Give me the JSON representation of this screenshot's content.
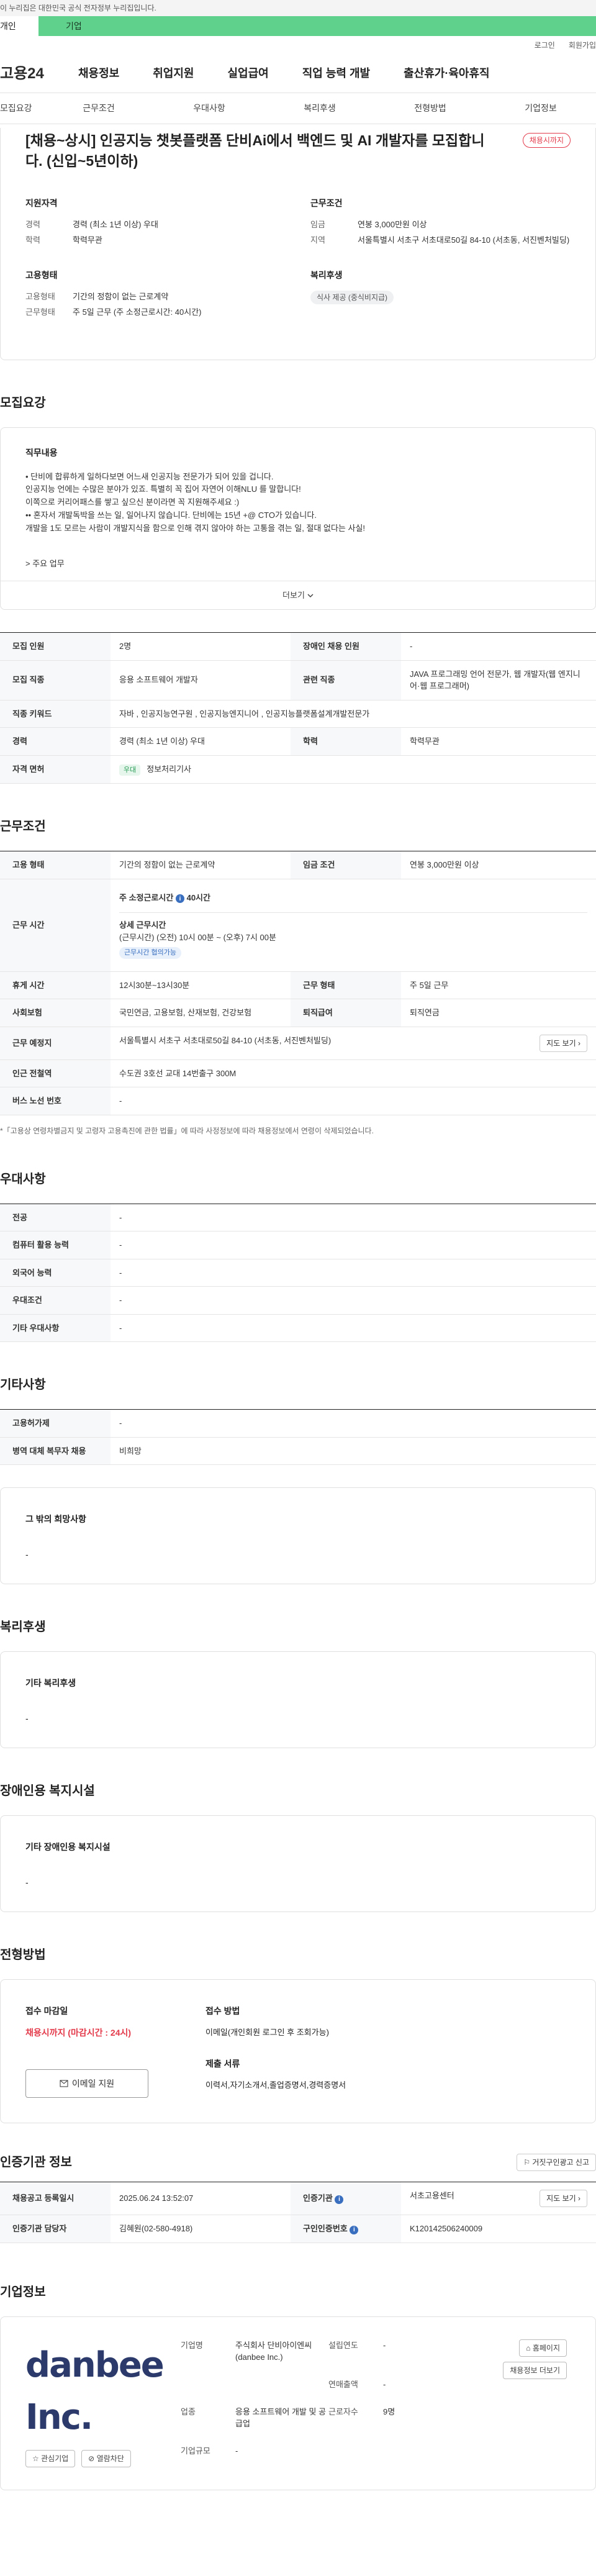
{
  "gov_banner": "이 누리집은 대한민국 공식 전자정부 누리집입니다.",
  "top_tabs": [
    "개인",
    "기업"
  ],
  "util_links": [
    "로그인",
    "회원가입"
  ],
  "logo": "고용24",
  "gnb": [
    "채용정보",
    "취업지원",
    "실업급여",
    "직업 능력 개발",
    "출산휴가·육아휴직"
  ],
  "subnav": [
    "모집요강",
    "근무조건",
    "우대사항",
    "복리후생",
    "전형방법",
    "기업정보"
  ],
  "summary": {
    "title": "[채용~상시] 인공지능 챗봇플랫폼 단비Ai에서 백엔드 및 AI 개발자를 모집합니다. (신입~5년이하)",
    "status_badge": "채용시까지",
    "qualification": {
      "heading": "지원자격",
      "rows": [
        {
          "k": "경력",
          "v": "경력 (최소 1년 이상) 우대"
        },
        {
          "k": "학력",
          "v": "학력무관"
        }
      ]
    },
    "work_conditions": {
      "heading": "근무조건",
      "rows": [
        {
          "k": "임금",
          "v": "연봉 3,000만원 이상"
        },
        {
          "k": "지역",
          "v": "서울특별시 서초구 서초대로50길 84-10 (서초동, 서진벤처빌딩)"
        }
      ]
    },
    "employment_type": {
      "heading": "고용형태",
      "rows": [
        {
          "k": "고용형태",
          "v": "기간의 정함이 없는 근로계약"
        },
        {
          "k": "근무형태",
          "v": "주 5일 근무 (주 소정근로시간: 40시간)"
        }
      ]
    },
    "welfare": {
      "heading": "복리후생",
      "pill": "식사 제공 (중식비지급)"
    }
  },
  "recruit": {
    "heading": "모집요강",
    "duty_heading": "직무내용",
    "duty_text": "• 단비에 합류하게 일하다보면 어느새 인공지능 전문가가 되어 있을 겁니다.\n 인공지능 언에는 수많은 분야가 있죠. 특별히 꼭 집어 자연어 이해NLU 를 말합니다!\n 이쪽으로 커리어패스를 쌓고 싶으신 분이라면 꼭 지원해주세요 :)\n•• 혼자서 개발독박을 쓰는 일, 일어나지 않습니다. 단비에는 15년 +@ CTO가 있습니다.\n 개발을 1도 모르는 사람이 개발지식을 함으로 인해 겪지 않아야 하는 고통을 겪는 일, 절대 없다는 사실!",
    "duty_more": "> 주요 업무",
    "more_button": "더보기",
    "table": [
      {
        "k1": "모집 인원",
        "v1": "2명",
        "k2": "장애인 채용 인원",
        "v2": "-"
      },
      {
        "k1": "모집 직종",
        "v1": "응용 소프트웨어 개발자",
        "k2": "관련 직종",
        "v2": "JAVA 프로그래밍 언어 전문가, 웹 개발자(웹 엔지니어·웹 프로그래머)"
      },
      {
        "k1": "직종 키워드",
        "v1": "자바 , 인공지능연구원 , 인공지능엔지니어 , 인공지능플랫폼설계개발전문가"
      },
      {
        "k1": "경력",
        "v1": "경력 (최소 1년 이상) 우대",
        "k2": "학력",
        "v2": "학력무관"
      },
      {
        "k1": "자격 면허",
        "tag": "우대",
        "v1": "정보처리기사"
      }
    ]
  },
  "conditions": {
    "heading": "근무조건",
    "employment_form_k": "고용 형태",
    "employment_form_v": "기간의 정함이 없는 근로계약",
    "wage_k": "임금 조건",
    "wage_v": "연봉 3,000만원 이상",
    "hours_k": "근무 시간",
    "hours_total": "주 소정근로시간",
    "hours_total_val": "40시간",
    "hours_detail_h": "상세 근무시간",
    "hours_detail": "(근무시간) (오전) 10시 00분 ~ (오후) 7시 00분",
    "hours_pill": "근무시간 협의가능",
    "break_k": "휴게 시간",
    "break_v": "12시30분~13시30분",
    "form_k": "근무 형태",
    "form_v": "주 5일 근무",
    "insurance_k": "사회보험",
    "insurance_v": "국민연금, 고용보험, 산재보험, 건강보험",
    "retire_k": "퇴직급여",
    "retire_v": "퇴직연금",
    "location_k": "근무 예정지",
    "location_v": "서울특별시 서초구 서초대로50길 84-10 (서초동, 서진벤처빌딩)",
    "map_button": "지도 보기",
    "station_k": "인근 전철역",
    "station_v": "수도권 3호선 교대 14번출구 300M",
    "bus_k": "버스 노선 번호",
    "bus_v": "-",
    "note": "*「고용상 연령차별금지 및 고령자 고용촉진에 관한 법률」에 따라 사정정보에 따라 채용정보에서 연령이 삭제되었습니다."
  },
  "preference": {
    "heading": "우대사항",
    "rows": [
      {
        "k": "전공",
        "v": "-"
      },
      {
        "k": "컴퓨터 활용 능력",
        "v": "-"
      },
      {
        "k": "외국어 능력",
        "v": "-"
      },
      {
        "k": "우대조건",
        "v": "-"
      },
      {
        "k": "기타 우대사항",
        "v": "-"
      }
    ]
  },
  "etc": {
    "heading": "기타사항",
    "rows": [
      {
        "k": "고용허가제",
        "v": "-"
      },
      {
        "k": "병역 대체 복무자 채용",
        "v": "비희망"
      }
    ],
    "card_k": "그 밖의 희망사항",
    "card_v": "-"
  },
  "welfare": {
    "heading": "복리후생",
    "card_k": "기타 복리후생",
    "card_v": "-"
  },
  "disabled": {
    "heading": "장애인용 복지시설",
    "card_k": "기타 장애인용 복지시설",
    "card_v": "-"
  },
  "process": {
    "heading": "전형방법",
    "deadline_h": "접수 마감일",
    "deadline_v": "채용시까지 (마감시간 : 24시)",
    "apply_button": "이메일 지원",
    "method_h": "접수 방법",
    "method_v": "이메일(개인회원 로그인 후 조회가능)",
    "docs_h": "제출 서류",
    "docs_v": "이력서,자기소개서,졸업증명서,경력증명서"
  },
  "agency": {
    "heading": "인증기관 정보",
    "report_button": "거짓구인광고 신고",
    "rows": [
      {
        "k1": "채용공고 등록일시",
        "v1": "2025.06.24 13:52:07",
        "k2": "인증기관",
        "v2": "서초고용센터",
        "btn": "지도 보기"
      },
      {
        "k1": "인증기관 담당자",
        "v1": "김혜원(02-580-4918)",
        "k2": "구인인증번호",
        "v2": "K120142506240009"
      }
    ]
  },
  "company": {
    "heading": "기업정보",
    "logo_text": "danbee Inc.",
    "fav_button": "관심기업",
    "block_button": "열람차단",
    "name_k": "기업명",
    "name_v": "주식회사 단비아이엔씨(danbee Inc.)",
    "industry_k": "업종",
    "industry_v": "응용 소프트웨어 개발 및 공급업",
    "size_k": "기업규모",
    "size_v": "-",
    "year_k": "설립연도",
    "year_v": "-",
    "sales_k": "연매출액",
    "sales_v": "-",
    "emp_k": "근로자수",
    "emp_v": "9명",
    "homepage_button": "홈페이지",
    "other_jobs_button": "채용정보 더보기"
  }
}
